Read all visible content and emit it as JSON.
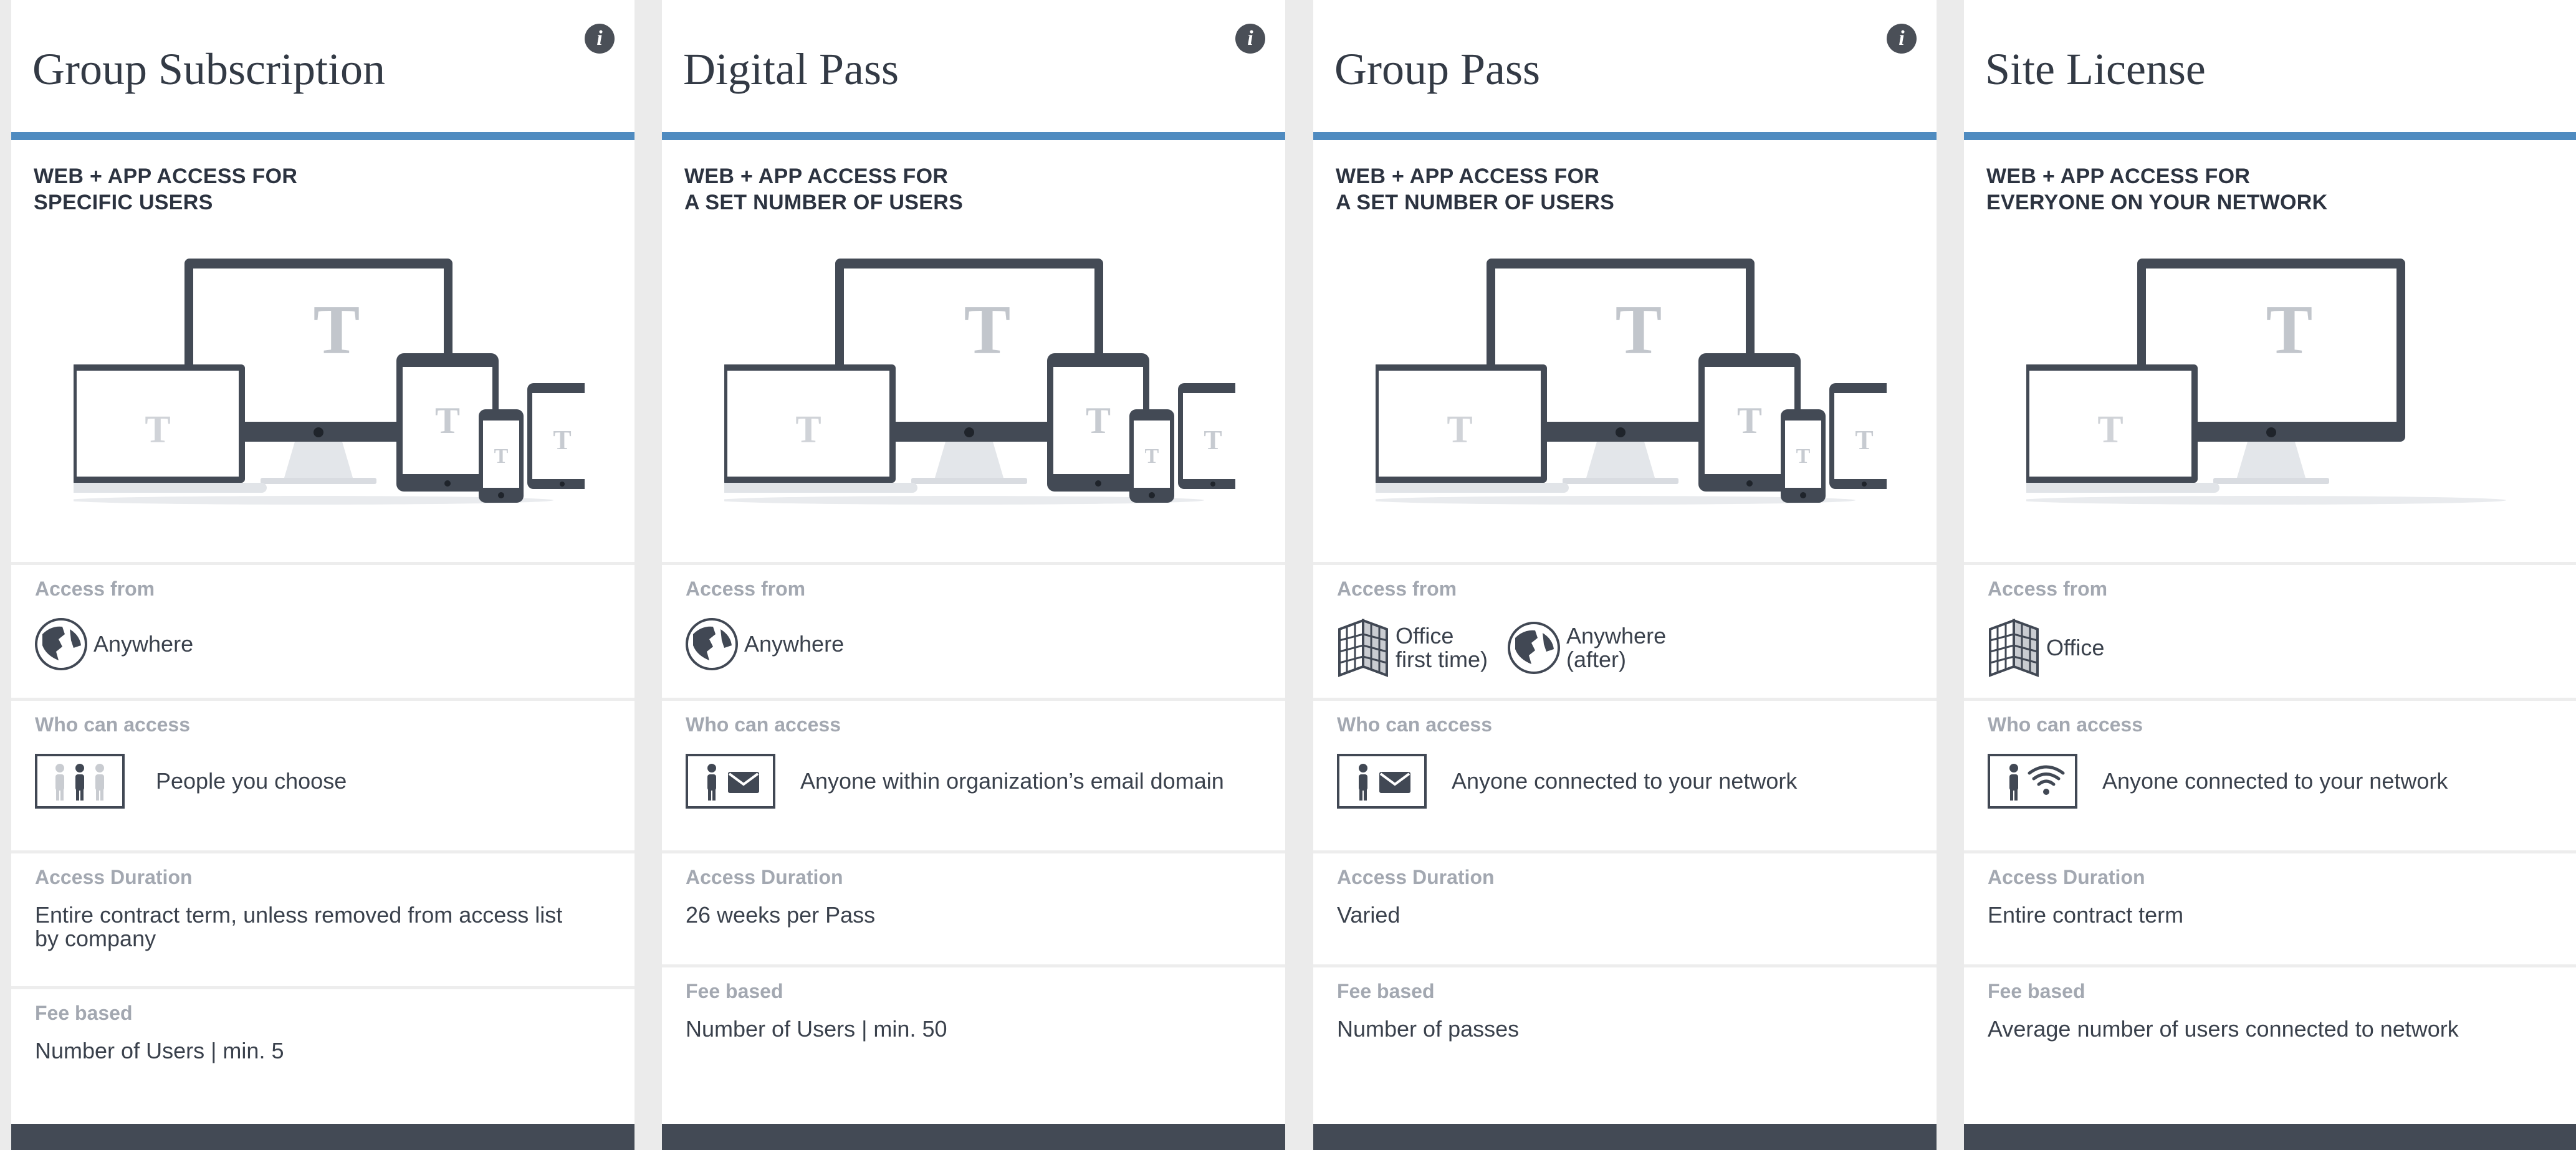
{
  "labels": {
    "access_from": "Access from",
    "who_can_access": "Who can access",
    "access_duration": "Access Duration",
    "fee_based": "Fee based"
  },
  "info_icon_glyph": "i",
  "colors": {
    "accent_rule": "#4f8bc0",
    "dark": "#434a55",
    "label_gray": "#a3a8b1"
  },
  "cards": [
    {
      "title": "Group Subscription",
      "subtitle": "WEB + APP ACCESS FOR\nSPECIFIC USERS",
      "access_from": [
        {
          "icon": "globe-icon",
          "text": "Anywhere"
        }
      ],
      "who_icon": "three-people-icon",
      "who_text": "People you choose",
      "duration": "Entire contract term, unless removed from access list by company",
      "fee": "Number of Users | min. 5"
    },
    {
      "title": "Digital Pass",
      "subtitle": "WEB + APP ACCESS FOR\nA SET NUMBER OF USERS",
      "access_from": [
        {
          "icon": "globe-icon",
          "text": "Anywhere"
        }
      ],
      "who_icon": "person-email-icon",
      "who_text": "Anyone within organization’s email domain",
      "duration": "26 weeks per Pass",
      "fee": "Number of Users | min. 50"
    },
    {
      "title": "Group Pass",
      "subtitle": "WEB + APP ACCESS FOR\nA SET NUMBER OF USERS",
      "access_from": [
        {
          "icon": "building-icon",
          "text": "Office\nfirst time)"
        },
        {
          "icon": "globe-icon",
          "text": "Anywhere\n(after)"
        }
      ],
      "who_icon": "person-email-icon",
      "who_text": "Anyone connected to your network",
      "duration": "Varied",
      "fee": "Number of passes"
    },
    {
      "title": "Site License",
      "subtitle": "WEB + APP ACCESS FOR\nEVERYONE ON YOUR NETWORK",
      "access_from": [
        {
          "icon": "building-icon",
          "text": "Office"
        }
      ],
      "who_icon": "person-wifi-icon",
      "who_text": "Anyone connected to your network",
      "duration": "Entire contract term",
      "fee": "Average number of users connected to network"
    }
  ]
}
